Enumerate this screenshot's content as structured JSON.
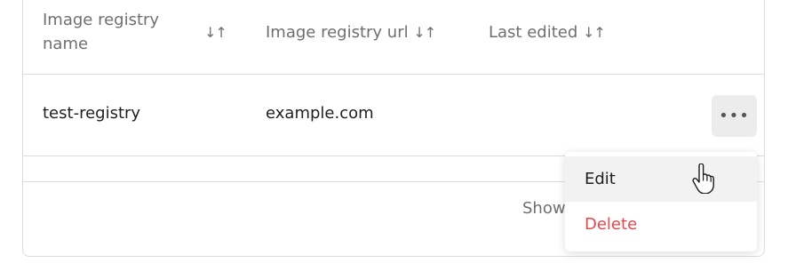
{
  "table": {
    "headers": [
      {
        "label": "Image registry name",
        "sort": "↓↑"
      },
      {
        "label": "Image registry url",
        "sort": "↓↑"
      },
      {
        "label": "Last edited",
        "sort": "↓↑"
      }
    ],
    "rows": [
      {
        "name": "test-registry",
        "url": "example.com",
        "last_edited": ""
      }
    ],
    "more_button_icon": "more-horizontal-icon",
    "more_glyph": "•••"
  },
  "footer": {
    "text": "Show"
  },
  "context_menu": {
    "items": [
      {
        "label": "Edit",
        "state": "hover"
      },
      {
        "label": "Delete",
        "color": "#e5484d"
      }
    ]
  },
  "colors": {
    "border": "#dcdcdc",
    "muted_text": "#6f6f6f",
    "danger": "#e5484d",
    "button_bg": "#ececec"
  }
}
